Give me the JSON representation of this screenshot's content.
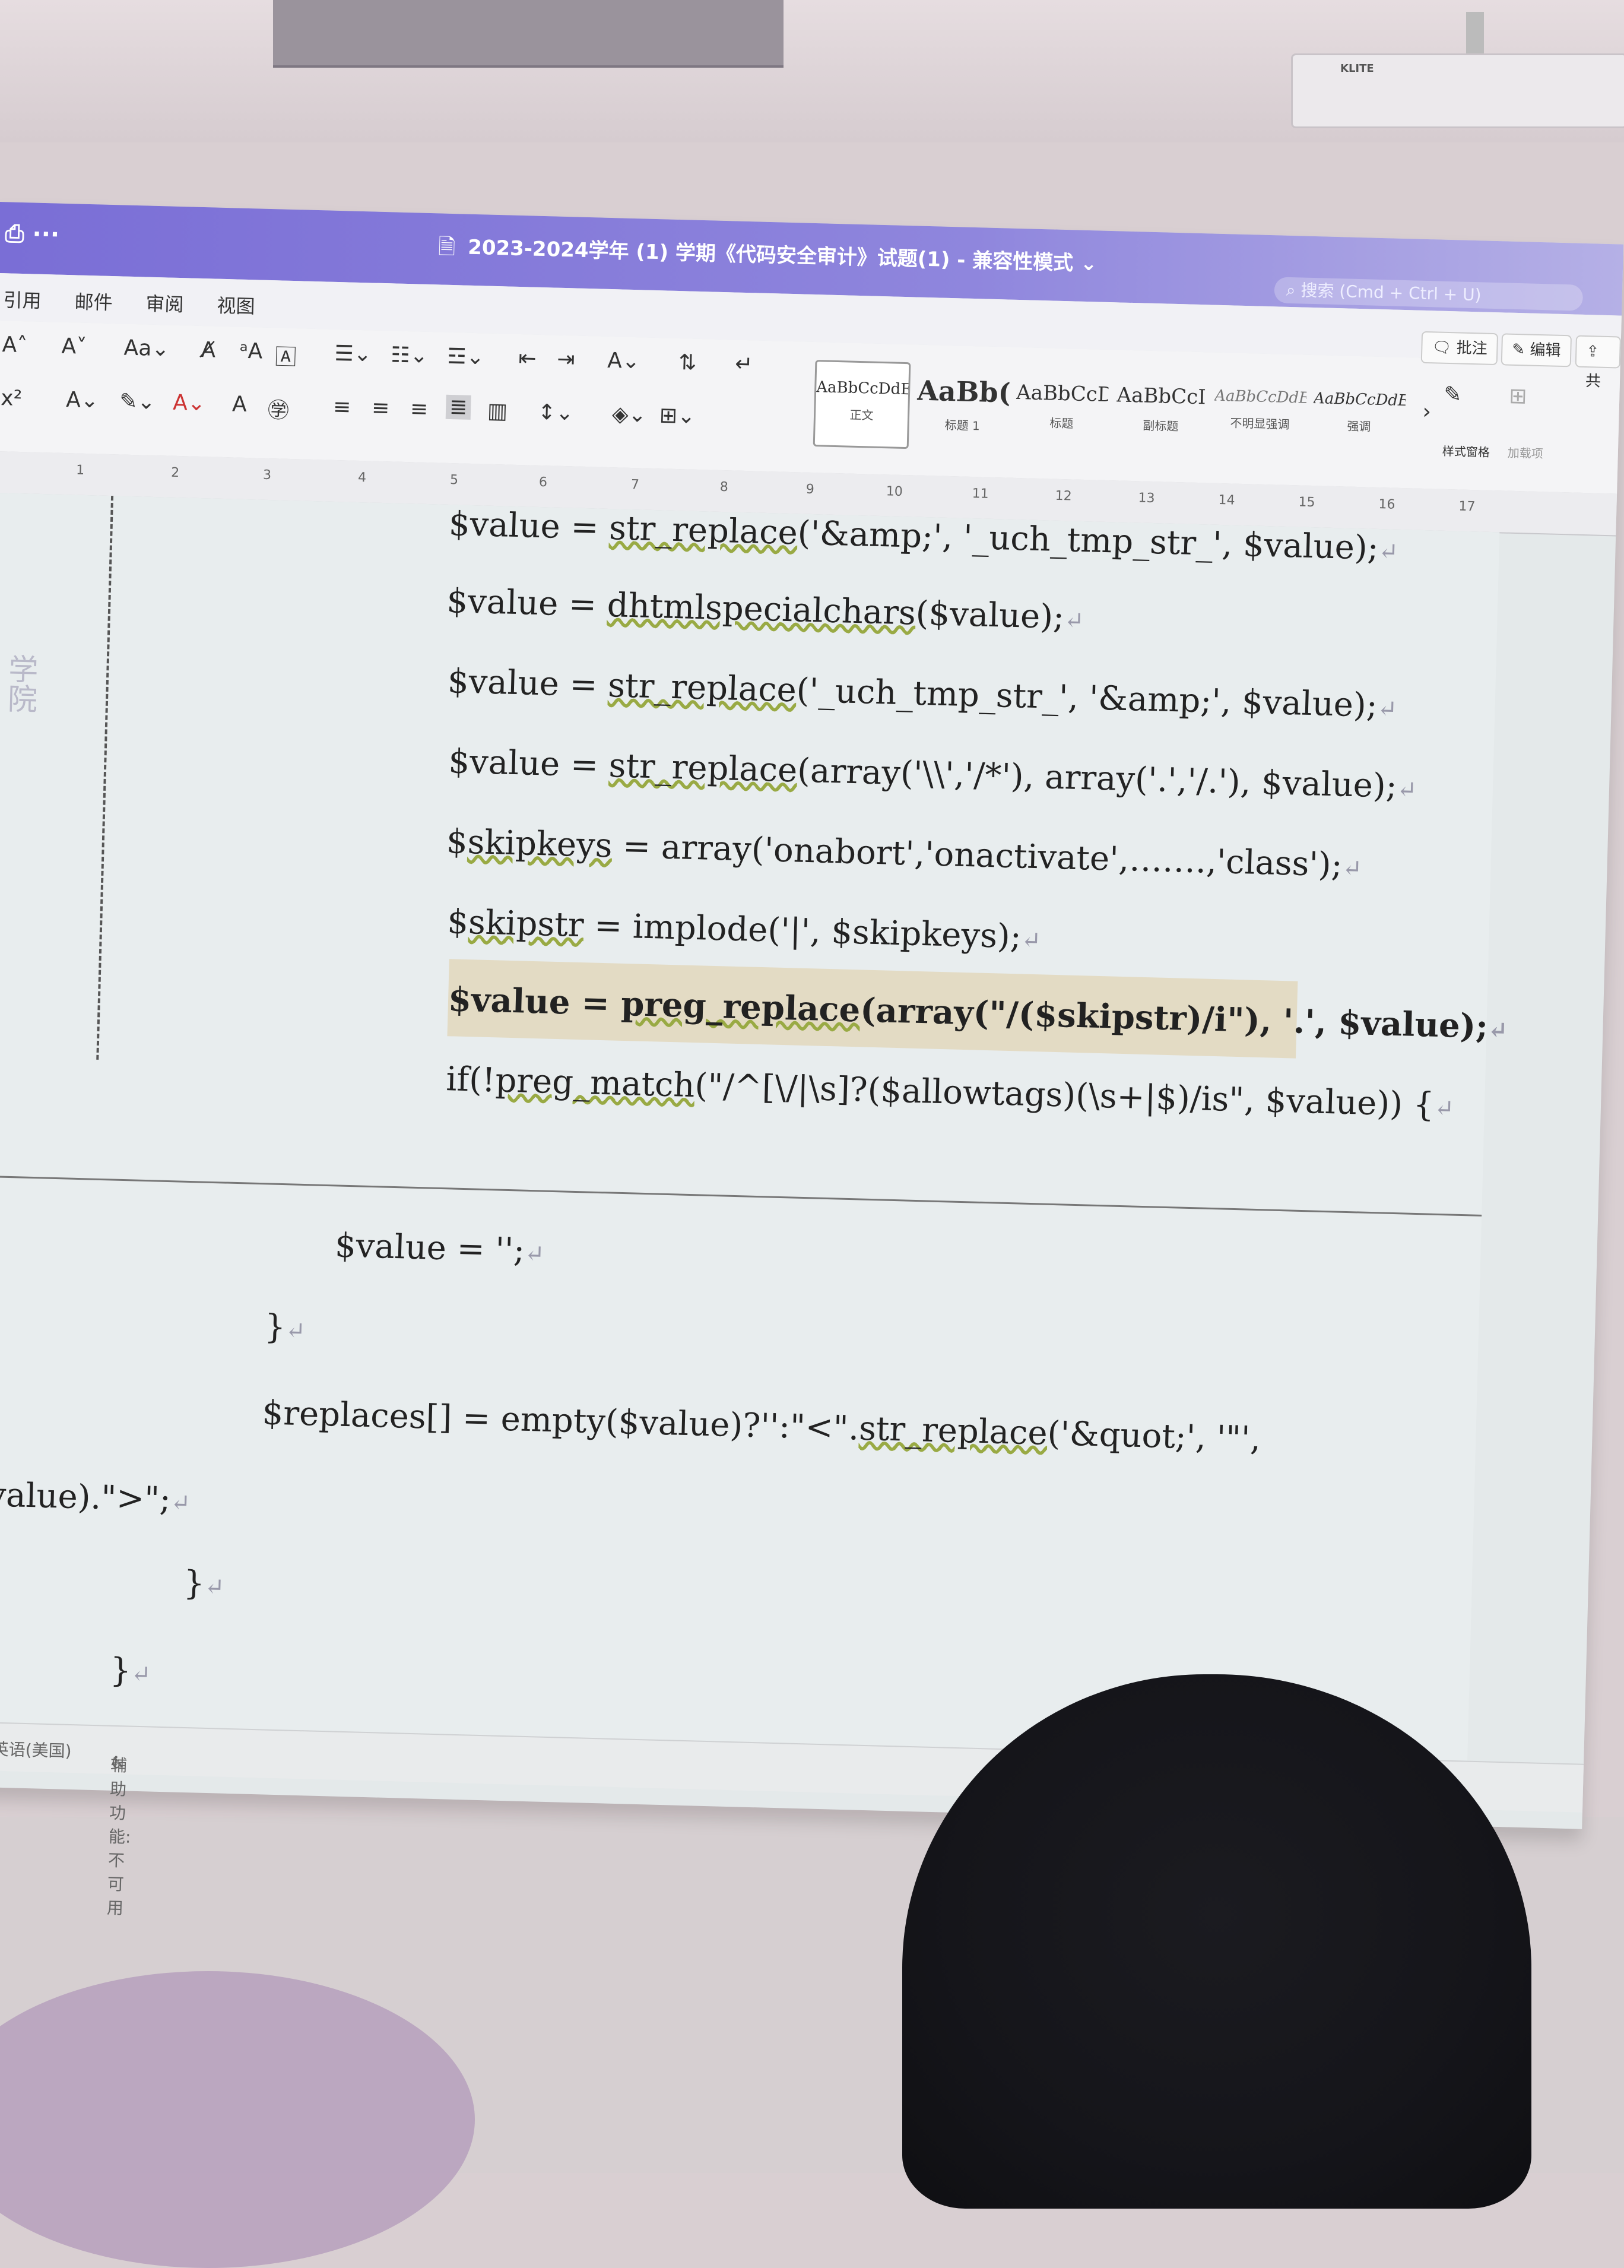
{
  "window": {
    "title": "2023-2024学年 (1) 学期《代码安全审计》试题(1) - 兼容性模式 ⌄",
    "search_placeholder": "搜索 (Cmd + Ctrl + U)"
  },
  "projector": {
    "brand": "KLITE"
  },
  "menu": [
    "引用",
    "邮件",
    "审阅",
    "视图"
  ],
  "ribbon": {
    "styles": [
      {
        "sample": "AaBbCcDdEe",
        "caption": "正文"
      },
      {
        "sample": "AaBb(",
        "caption": "标题 1"
      },
      {
        "sample": "AaBbCcDd",
        "caption": "标题"
      },
      {
        "sample": "AaBbCcI",
        "caption": "副标题"
      },
      {
        "sample": "AaBbCcDdEe",
        "caption": "不明显强调"
      },
      {
        "sample": "AaBbCcDdEe",
        "caption": "强调"
      }
    ],
    "styles_pane_label": "样式窗格",
    "addins_label": "加载项",
    "comment_button": "批注",
    "edit_button": "编辑",
    "share_button": "共"
  },
  "ruler": [
    "1",
    "2",
    "3",
    "4",
    "5",
    "6",
    "7",
    "8",
    "9",
    "10",
    "11",
    "12",
    "13",
    "14",
    "15",
    "16",
    "17"
  ],
  "side_mark": "学院",
  "code_lines": [
    {
      "parts": [
        "$value = ",
        "str_replace",
        "('&amp;', '_uch_tmp_str_', $value);"
      ]
    },
    {
      "parts": [
        "$value = ",
        "dhtmlspecialchars",
        "($value);"
      ]
    },
    {
      "parts": [
        "$value = ",
        "str_replace",
        "('_uch_tmp_str_', '&amp;', $value);"
      ]
    },
    {
      "parts": [
        "$value = ",
        "str_replace",
        "(array('\\\\','/*'), array('.','/.'), $value);"
      ]
    },
    {
      "parts": [
        "$",
        "skipkeys",
        " = array('onabort','onactivate',…….,'class');"
      ]
    },
    {
      "parts": [
        "$",
        "skipstr",
        " = implode('|', $skipkeys);"
      ]
    },
    {
      "parts": [
        "$value = ",
        "preg_replace",
        "(array(\"/($skipstr)/i\"), '.', $value);"
      ]
    },
    {
      "parts": [
        "if(!",
        "preg_match",
        "(\"/^[\\/|\\s]?($allowtags)(\\s+|$)/is\", $value)) {"
      ]
    },
    {
      "parts": [
        "$value = '';",
        "",
        ""
      ]
    },
    {
      "parts": [
        "}",
        "",
        ""
      ]
    },
    {
      "parts": [
        "$replaces[]    =    empty($value)?'':\"<\".",
        "str_replace",
        "('&quot;',    '\"',"
      ]
    },
    {
      "parts": [
        "$value).\">\";",
        "",
        ""
      ]
    },
    {
      "parts": [
        "}",
        "",
        ""
      ]
    },
    {
      "parts": [
        "}",
        "",
        ""
      ]
    }
  ],
  "return_mark": "↵",
  "status": {
    "language": "英语(美国)",
    "accessibility": "辅助功能: 不可用"
  }
}
